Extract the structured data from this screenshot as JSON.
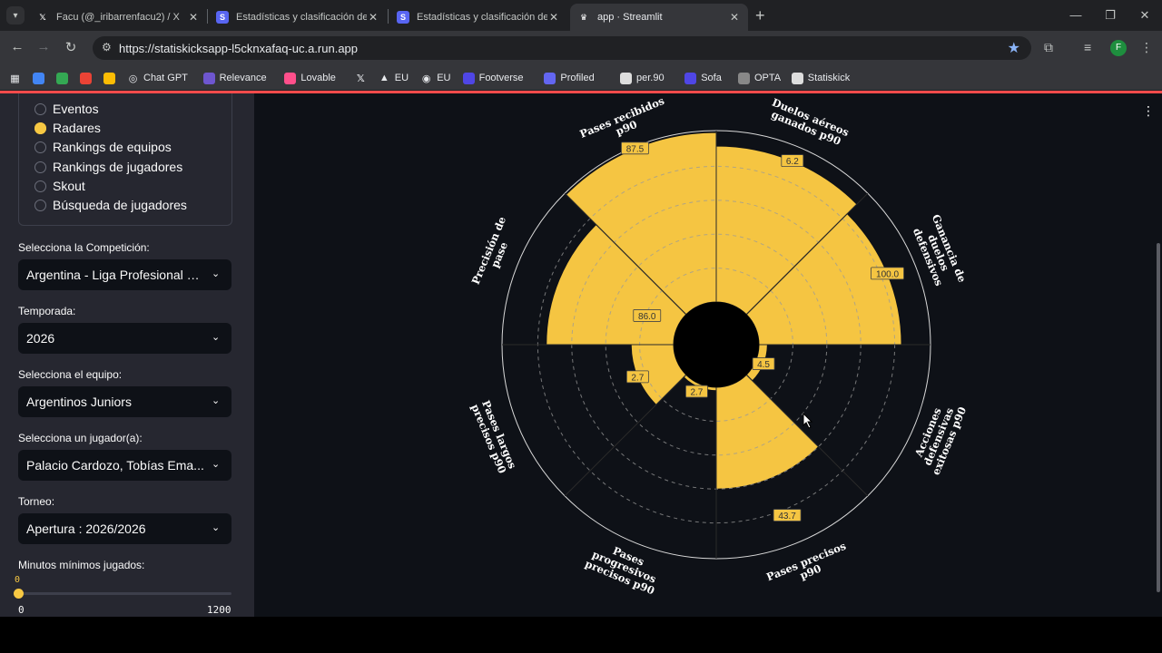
{
  "browser": {
    "tabs": [
      {
        "title": "Facu (@_iribarrenfacu2) / X",
        "favicon": "x-icon"
      },
      {
        "title": "Estadísticas y clasificación de To",
        "favicon": "statiskick-icon"
      },
      {
        "title": "Estadísticas y clasificación de To",
        "favicon": "statiskick-icon"
      },
      {
        "title": "app · Streamlit",
        "favicon": "streamlit-icon",
        "active": true
      }
    ],
    "url": "https://statiskicksapp-l5cknxafaq-uc.a.run.app",
    "profile_initial": "F",
    "bookmarks": [
      {
        "label": "",
        "icon": "apps-icon"
      },
      {
        "label": "",
        "icon": "ext-icon-1"
      },
      {
        "label": "",
        "icon": "ext-icon-2"
      },
      {
        "label": "",
        "icon": "ext-icon-3"
      },
      {
        "label": "",
        "icon": "drive-icon"
      },
      {
        "label": "Chat GPT",
        "icon": "chatgpt-icon"
      },
      {
        "label": "Relevance",
        "icon": "relevance-icon"
      },
      {
        "label": "Lovable",
        "icon": "lovable-icon"
      },
      {
        "label": "",
        "icon": "x-icon"
      },
      {
        "label": "EU",
        "icon": "eu-icon"
      },
      {
        "label": "EU",
        "icon": "eu2-icon"
      },
      {
        "label": "Footverse",
        "icon": "footverse-icon"
      },
      {
        "label": "Profiled",
        "icon": "profiled-icon"
      },
      {
        "label": "per.90",
        "icon": "per90-icon"
      },
      {
        "label": "Sofa",
        "icon": "sofa-icon"
      },
      {
        "label": "OPTA",
        "icon": "opta-icon"
      },
      {
        "label": "Statiskick",
        "icon": "statiskick-icon"
      }
    ]
  },
  "sidebar": {
    "options": [
      "Eventos",
      "Radares",
      "Rankings de equipos",
      "Rankings de jugadores",
      "Skout",
      "Búsqueda de jugadores"
    ],
    "selected_option": "Radares",
    "competition_label": "Selecciona la Competición:",
    "competition_value": "Argentina - Liga Profesional d...",
    "season_label": "Temporada:",
    "season_value": "2026",
    "team_label": "Selecciona el equipo:",
    "team_value": "Argentinos Juniors",
    "player_label": "Selecciona un jugador(a):",
    "player_value": "Palacio Cardozo, Tobías Ema...",
    "tournament_label": "Torneo:",
    "tournament_value": "Apertura : 2026/2026",
    "minutes_label": "Minutos mínimos jugados:",
    "minutes_value": "0",
    "minutes_min": "0",
    "minutes_max": "1200",
    "minutes_fraction": 0
  },
  "chart_data": {
    "type": "radar",
    "categories": [
      "Pases recibidos p90",
      "Duelos aéreos ganados p90",
      "Ganancia de duelos defensivos",
      "Acciones defensivas exitosas p90",
      "Pases precisos p90",
      "Pases progresivos precisos p90",
      "Pases largos precisos p90",
      "Precisión de pase"
    ],
    "values": [
      87.5,
      6.2,
      100.0,
      4.5,
      43.7,
      2.7,
      2.7,
      86.0
    ],
    "value_labels": [
      "87.5",
      "6.2",
      "100.0",
      "4.5",
      "43.7",
      "2.7",
      "2.7",
      "86.0"
    ],
    "slice_fraction": [
      1.0,
      0.92,
      0.84,
      0.05,
      0.6,
      0.02,
      0.25,
      0.75
    ],
    "label_fraction": [
      1.0,
      0.92,
      0.84,
      0.05,
      0.84,
      0.05,
      0.25,
      0.19
    ],
    "slice_color": "#f5c542",
    "background_color": "#0e1117"
  },
  "colors": {
    "accent": "#f7c843",
    "sidebar_bg": "#262730",
    "main_bg": "#0e1117",
    "header_line": "#ff4b4b"
  }
}
